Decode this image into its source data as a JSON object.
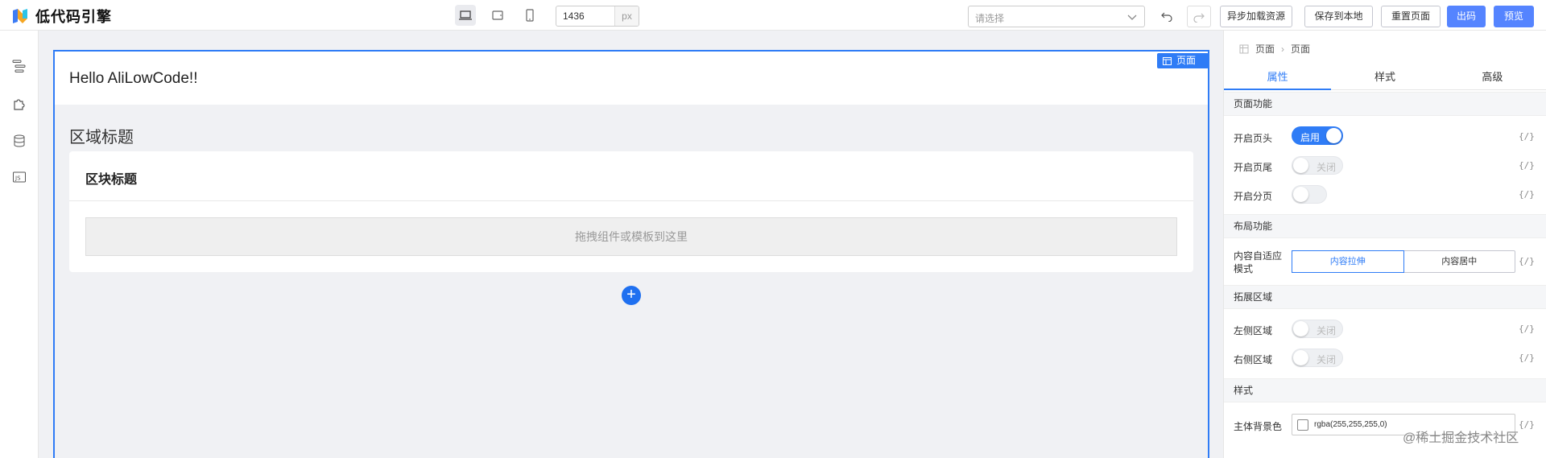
{
  "app": {
    "title": "低代码引擎"
  },
  "toolbar": {
    "width_value": "1436",
    "width_unit": "px",
    "select_placeholder": "请选择",
    "buttons": {
      "async_load": "异步加载资源",
      "save_local": "保存到本地",
      "reset_page": "重置页面",
      "export_code": "出码",
      "preview": "预览"
    }
  },
  "canvas": {
    "page_tag": "页面",
    "hello": "Hello AliLowCode!!",
    "region_title": "区域标题",
    "block_title": "区块标题",
    "drop_hint": "拖拽组件或模板到这里",
    "add_symbol": "+"
  },
  "panel": {
    "breadcrumb": [
      "页面",
      "页面"
    ],
    "tabs": [
      "属性",
      "样式",
      "高级"
    ],
    "groups": {
      "page_func": "页面功能",
      "layout_func": "布局功能",
      "ext_area": "拓展区域",
      "style": "样式"
    },
    "rows": {
      "header": {
        "label": "开启页头",
        "state": "启用"
      },
      "footer": {
        "label": "开启页尾",
        "state": "关闭"
      },
      "paging": {
        "label": "开启分页"
      },
      "content_mode": {
        "label": "内容自适应模式",
        "options": [
          "内容拉伸",
          "内容居中"
        ]
      },
      "left_area": {
        "label": "左侧区域",
        "state": "关闭"
      },
      "right_area": {
        "label": "右侧区域",
        "state": "关闭"
      },
      "bg_color": {
        "label": "主体背景色",
        "value": "rgba(255,255,255,0)"
      }
    },
    "var_icon": "{/}"
  },
  "watermark": "@稀土掘金技术社区",
  "colors": {
    "accent": "#2f7cf6",
    "primary_button": "#5584ff"
  }
}
